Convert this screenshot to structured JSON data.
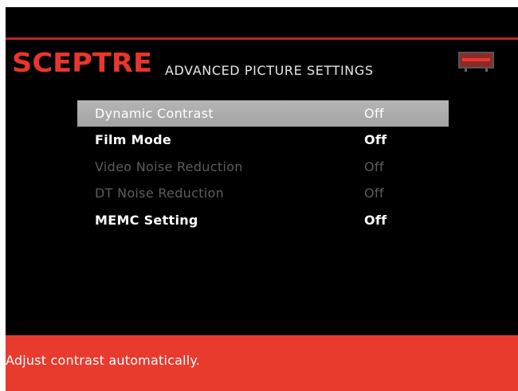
{
  "brand": {
    "logo_text": "SCEPTRE",
    "logo_color": "#e8362c"
  },
  "header": {
    "title": "ADVANCED PICTURE SETTINGS",
    "badge_icon": "sceptre-tv-badge-icon"
  },
  "menu": {
    "items": [
      {
        "label": "Dynamic Contrast",
        "value": "Off",
        "state": "selected"
      },
      {
        "label": "Film Mode",
        "value": "Off",
        "state": "enabled"
      },
      {
        "label": "Video Noise Reduction",
        "value": "Off",
        "state": "disabled"
      },
      {
        "label": "DT Noise Reduction",
        "value": "Off",
        "state": "disabled"
      },
      {
        "label": "MEMC Setting",
        "value": "Off",
        "state": "enabled"
      }
    ]
  },
  "help": {
    "text": "Adjust contrast automatically."
  },
  "colors": {
    "accent_red": "#e93a2e",
    "rule_red": "#b8262a",
    "background": "#000000",
    "selected_row": "#aaaaaa",
    "disabled_text": "#5d5d5d"
  }
}
